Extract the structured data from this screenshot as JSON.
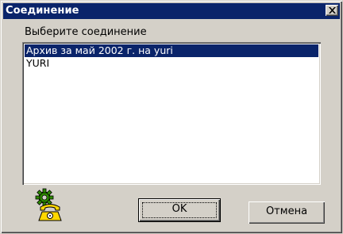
{
  "window": {
    "title": "Соединение",
    "close_icon": "close-icon"
  },
  "prompt": "Выберите соединение",
  "connections": [
    {
      "label": "Архив за май 2002 г. на yuri",
      "selected": true
    },
    {
      "label": "YURI",
      "selected": false
    }
  ],
  "icon": "connection-phone-gear-icon",
  "buttons": {
    "ok": "OK",
    "cancel": "Отмена"
  },
  "colors": {
    "titlebar": "#0a246a",
    "selection": "#0a246a",
    "face": "#d4d0c8"
  }
}
